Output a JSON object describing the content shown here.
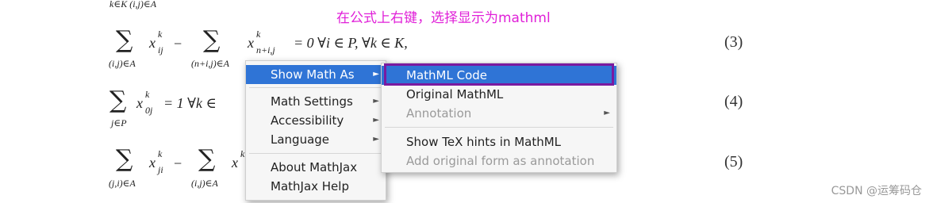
{
  "annotation_text": "在公式上右键，选择显示为mathml",
  "watermark": "CSDN @运筹码仓",
  "math": {
    "top_fragment": "k∈K (i,j)∈A",
    "eq3": {
      "sum1_under": "(i,j)∈A",
      "term1": "x",
      "term1_sup": "k",
      "term1_sub": "ij",
      "minus": "−",
      "sum2_under": "(n+i,j)∈A",
      "term2": "x",
      "term2_sup": "k",
      "term2_sub": "n+i,j",
      "rest": "= 0   ∀i ∈ P, ∀k ∈ K,",
      "number": "(3)"
    },
    "eq4": {
      "sum_under": "j∈P",
      "term": "x",
      "term_sup": "k",
      "term_sub": "0j",
      "rest": "= 1   ∀k ∈",
      "number": "(4)"
    },
    "eq5": {
      "sum1_under": "(j,i)∈A",
      "term1": "x",
      "term1_sup": "k",
      "term1_sub": "ji",
      "minus": "−",
      "sum2_under": "(i,j)∈A",
      "term2": "x",
      "term2_sup": "k",
      "number": "(5)"
    },
    "sum_symbol": "∑"
  },
  "main_menu": {
    "items": [
      {
        "label": "Show Math As",
        "arrow": "►",
        "state": "active"
      },
      {
        "label": "Math Settings",
        "arrow": "►",
        "state": "normal"
      },
      {
        "label": "Accessibility",
        "arrow": "►",
        "state": "normal"
      },
      {
        "label": "Language",
        "arrow": "►",
        "state": "normal"
      },
      {
        "label": "About MathJax",
        "arrow": "",
        "state": "normal"
      },
      {
        "label": "MathJax Help",
        "arrow": "",
        "state": "normal"
      }
    ]
  },
  "submenu": {
    "items": [
      {
        "label": "MathML Code",
        "arrow": "",
        "state": "active"
      },
      {
        "label": "Original MathML",
        "arrow": "",
        "state": "normal"
      },
      {
        "label": "Annotation",
        "arrow": "►",
        "state": "disabled"
      },
      {
        "label": "Show TeX hints in MathML",
        "arrow": "",
        "state": "normal"
      },
      {
        "label": "Add original form as annotation",
        "arrow": "",
        "state": "disabled"
      }
    ]
  },
  "colors": {
    "annotation": "#e020d8",
    "menu_highlight": "#2f74d6",
    "outline_box": "#7a1aa0"
  }
}
